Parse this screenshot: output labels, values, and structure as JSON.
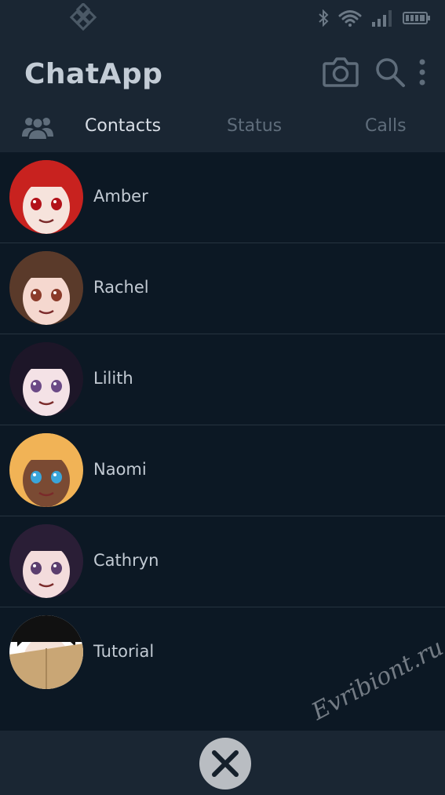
{
  "app": {
    "title": "ChatApp"
  },
  "tabs": [
    {
      "label": "Contacts",
      "active": true
    },
    {
      "label": "Status",
      "active": false
    },
    {
      "label": "Calls",
      "active": false
    }
  ],
  "contacts": [
    {
      "name": "Amber",
      "avatar": {
        "hair": "#c8221f",
        "skin": "#f6e3dc",
        "eyes": "#b3121a"
      }
    },
    {
      "name": "Rachel",
      "avatar": {
        "hair": "#5a3a2a",
        "skin": "#f5d8cf",
        "eyes": "#8a3b2a"
      }
    },
    {
      "name": "Lilith",
      "avatar": {
        "hair": "#1d1628",
        "skin": "#f4e2e6",
        "eyes": "#6b4a86"
      }
    },
    {
      "name": "Naomi",
      "avatar": {
        "hair": "#f1b356",
        "skin": "#7a4a33",
        "eyes": "#3aa5d9"
      }
    },
    {
      "name": "Cathryn",
      "avatar": {
        "hair": "#2a1e36",
        "skin": "#f3dcdc",
        "eyes": "#5b3e6e"
      }
    },
    {
      "name": "Tutorial",
      "avatar": {
        "hair": "#111111",
        "skin": "#f4e2d8",
        "eyes": "#222222",
        "box": "#c9a675"
      }
    }
  ],
  "watermark": "Evribiont.ru",
  "colors": {
    "background": "#0c1824",
    "bar": "#1a2633",
    "divider": "#26333f",
    "text": "#c2cad3",
    "muted": "#5f6d7b"
  }
}
